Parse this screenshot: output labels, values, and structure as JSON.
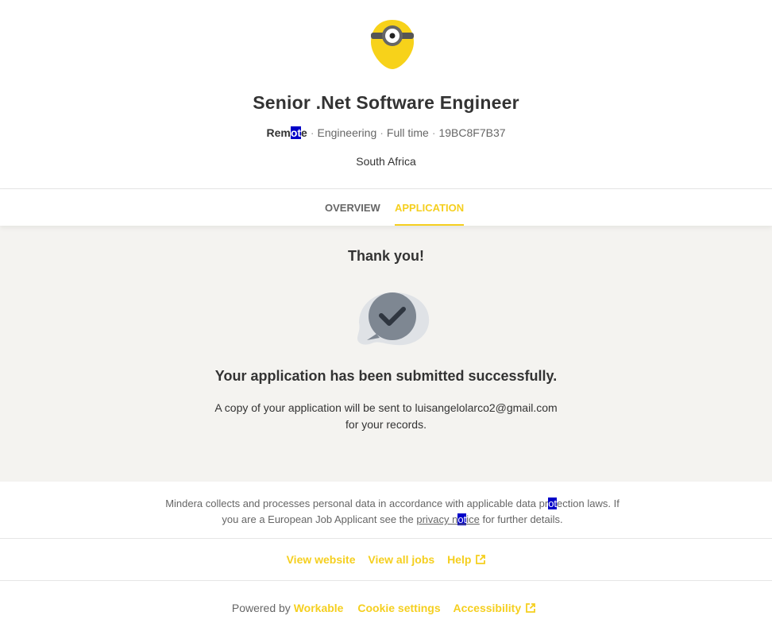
{
  "job": {
    "title": "Senior .Net Software Engineer",
    "workplace_pre": "Rem",
    "workplace_sel": "ot",
    "workplace_post": "e",
    "department": "Engineering",
    "type": "Full time",
    "code": "19BC8F7B37",
    "location": "South Africa"
  },
  "tabs": {
    "overview": "OVERVIEW",
    "application": "APPLICATION"
  },
  "main": {
    "thanks": "Thank you!",
    "success": "Your application has been submitted successfully.",
    "copy_line1": "A copy of your application will be sent to luisangelolarco2@gmail.com",
    "copy_line2": "for your records."
  },
  "legal": {
    "part1": "Mindera collects and processes personal data in accordance with applicable data pr",
    "sel1": "ot",
    "part2": "ection laws. If you are a European Job Applicant see the ",
    "link_pre": "privacy n",
    "link_sel": "ot",
    "link_post": "ice",
    "part3": " for further details."
  },
  "links": {
    "view_website": "View website",
    "view_all_jobs": "View all jobs",
    "help": "Help"
  },
  "footer": {
    "powered_by": "Powered by",
    "workable": "Workable",
    "cookie_settings": "Cookie settings",
    "accessibility": "Accessibility"
  },
  "colors": {
    "accent": "#f5cf1f",
    "background_main": "#f4f3f0",
    "selection": "#0000c8"
  },
  "icons": [
    "minion-logo-icon",
    "chat-check-icon",
    "external-link-icon"
  ]
}
